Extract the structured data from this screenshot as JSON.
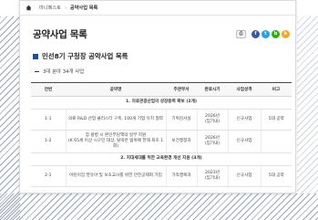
{
  "breadcrumb": {
    "items": [
      "마니페스토",
      "공약사업 목록"
    ]
  },
  "page": {
    "title": "공약사업 목록"
  },
  "share": {
    "print_label": "⎙",
    "facebook_label": "f",
    "twitter_label": "t",
    "blog_label": "b",
    "kakao_label": "k"
  },
  "section": {
    "title": "민선8기 구청장 공약사업 목록"
  },
  "subtitle": "3대 분야 34개 사업",
  "table": {
    "headers": [
      "연번",
      "공약명",
      "주관부서",
      "완료시기",
      "사업성격",
      "비고"
    ],
    "category1": "1. 의료관광산업의 성장동력 확보 (2개)",
    "row1": {
      "num": "1-1",
      "name": "의료 R&D 산업 클러스터 구축, 100개 기업 유치 협약",
      "dept": "기획감사실",
      "done_line1": "2026년",
      "done_line2": "(임기내)",
      "type": "신규사업",
      "note": "5대 공약"
    },
    "row2": {
      "num": "1-2",
      "name_line1": "암 왕병 시 본인부담액의 일부 지원",
      "name_line2": "(K 65세 이상 시구민 대상, 탈락은 범위에 한해 최초 1회)",
      "dept": "보건행정과",
      "done_line1": "2026년",
      "done_line2": "(임기내)",
      "type": "신규사업",
      "note": ""
    },
    "category2": "2. 지대세대를 위한 교육환경 개선 지원 (3개)",
    "row3": {
      "num": "2-1",
      "name": "어린이집 영유아 및 보호교사를 위한 안전공제회 가입",
      "dept": "가족행복과",
      "done_line1": "2023년",
      "done_line2": "(임기내)",
      "type": "신규사업",
      "note": "5대 공약"
    }
  }
}
